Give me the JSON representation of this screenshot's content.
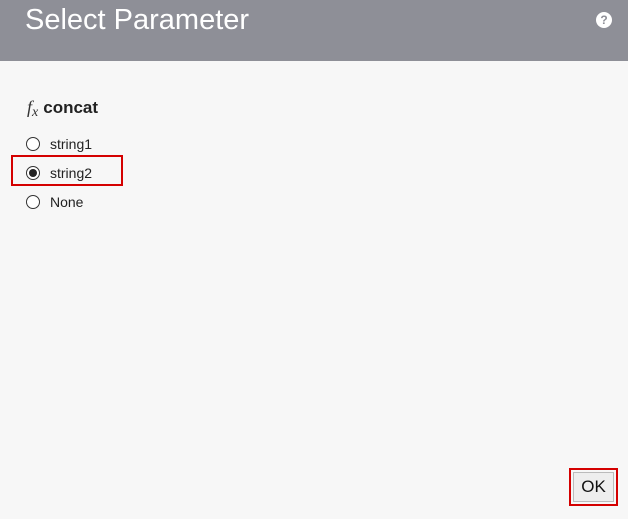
{
  "dialog": {
    "title": "Select Parameter",
    "help_icon": "help-icon",
    "help_glyph": "?"
  },
  "function": {
    "icon": "fx-icon",
    "icon_text": "f",
    "icon_sub": "x",
    "name": "concat"
  },
  "options": [
    {
      "label": "string1",
      "selected": false
    },
    {
      "label": "string2",
      "selected": true
    },
    {
      "label": "None",
      "selected": false
    }
  ],
  "footer": {
    "ok_label": "OK"
  },
  "colors": {
    "header_bg": "#8e8f97",
    "highlight": "#d40000",
    "page_bg": "#f7f7f7"
  }
}
